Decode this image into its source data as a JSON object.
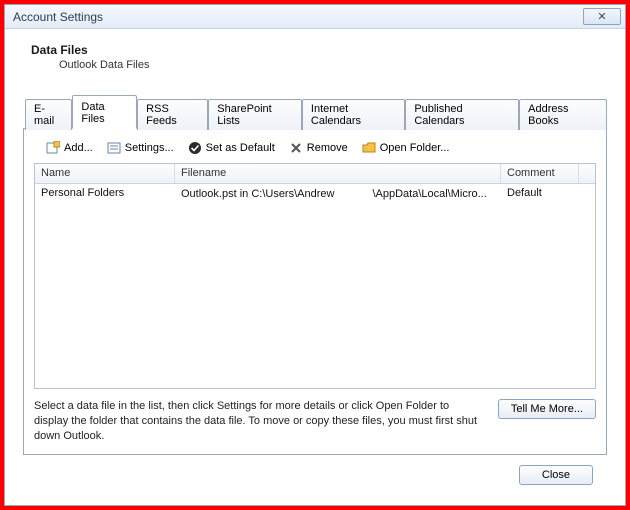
{
  "window": {
    "title": "Account Settings",
    "close_glyph": "✕"
  },
  "header": {
    "title": "Data Files",
    "subtitle": "Outlook Data Files"
  },
  "tabs": [
    {
      "label": "E-mail"
    },
    {
      "label": "Data Files"
    },
    {
      "label": "RSS Feeds"
    },
    {
      "label": "SharePoint Lists"
    },
    {
      "label": "Internet Calendars"
    },
    {
      "label": "Published Calendars"
    },
    {
      "label": "Address Books"
    }
  ],
  "toolbar": {
    "add": "Add...",
    "settings": "Settings...",
    "default": "Set as Default",
    "remove": "Remove",
    "open": "Open Folder..."
  },
  "columns": {
    "name": "Name",
    "filename": "Filename",
    "comment": "Comment"
  },
  "rows": [
    {
      "name": "Personal Folders",
      "filename_a": "Outlook.pst in C:\\Users\\Andrew",
      "filename_b": "\\AppData\\Local\\Micro...",
      "comment": "Default"
    }
  ],
  "help": {
    "text": "Select a data file in the list, then click Settings for more details or click Open Folder to display the folder that contains the data file. To move or copy these files, you must first shut down Outlook.",
    "button": "Tell Me More..."
  },
  "footer": {
    "close": "Close"
  }
}
